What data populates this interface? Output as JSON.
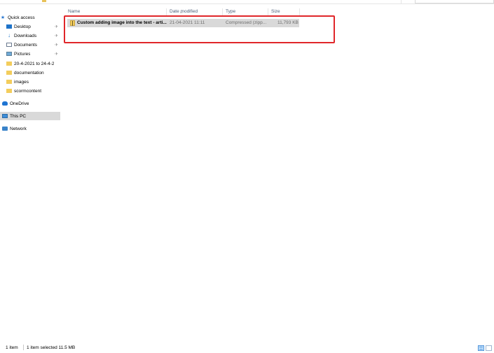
{
  "nav": {
    "items": [
      {
        "label": "Quick access",
        "icon": "star-icon",
        "pinned": false
      },
      {
        "label": "Desktop",
        "icon": "desktop-icon",
        "pinned": true
      },
      {
        "label": "Downloads",
        "icon": "downloads-icon",
        "pinned": true
      },
      {
        "label": "Documents",
        "icon": "documents-icon",
        "pinned": true
      },
      {
        "label": "Pictures",
        "icon": "pictures-icon",
        "pinned": true
      },
      {
        "label": "20-4-2021 to 24-4-2",
        "icon": "folder-icon",
        "pinned": false
      },
      {
        "label": "documentation",
        "icon": "folder-icon",
        "pinned": false
      },
      {
        "label": "images",
        "icon": "folder-icon",
        "pinned": false
      },
      {
        "label": "scormcontent",
        "icon": "folder-icon",
        "pinned": false
      },
      {
        "label": "OneDrive",
        "icon": "onedrive-icon",
        "pinned": false
      },
      {
        "label": "This PC",
        "icon": "computer-icon",
        "pinned": false,
        "selected": true
      },
      {
        "label": "Network",
        "icon": "network-icon",
        "pinned": false
      }
    ],
    "pin_glyph": "✈"
  },
  "columns": {
    "name": "Name",
    "date": "Date modified",
    "type": "Type",
    "size": "Size",
    "sort_glyph": "^"
  },
  "files": [
    {
      "name": "Custom adding image into the text - arti...",
      "date": "21-04-2021 11:11",
      "type": "Compressed (zipp...",
      "size": "11,793 KB",
      "icon": "zip-folder-icon",
      "selected": true
    }
  ],
  "status": {
    "item_count": "1 item",
    "selection": "1 item selected  11.5 MB"
  },
  "colors": {
    "highlight": "#e0262a",
    "selected_row": "#d9d9d9",
    "header_text": "#4c607a"
  }
}
